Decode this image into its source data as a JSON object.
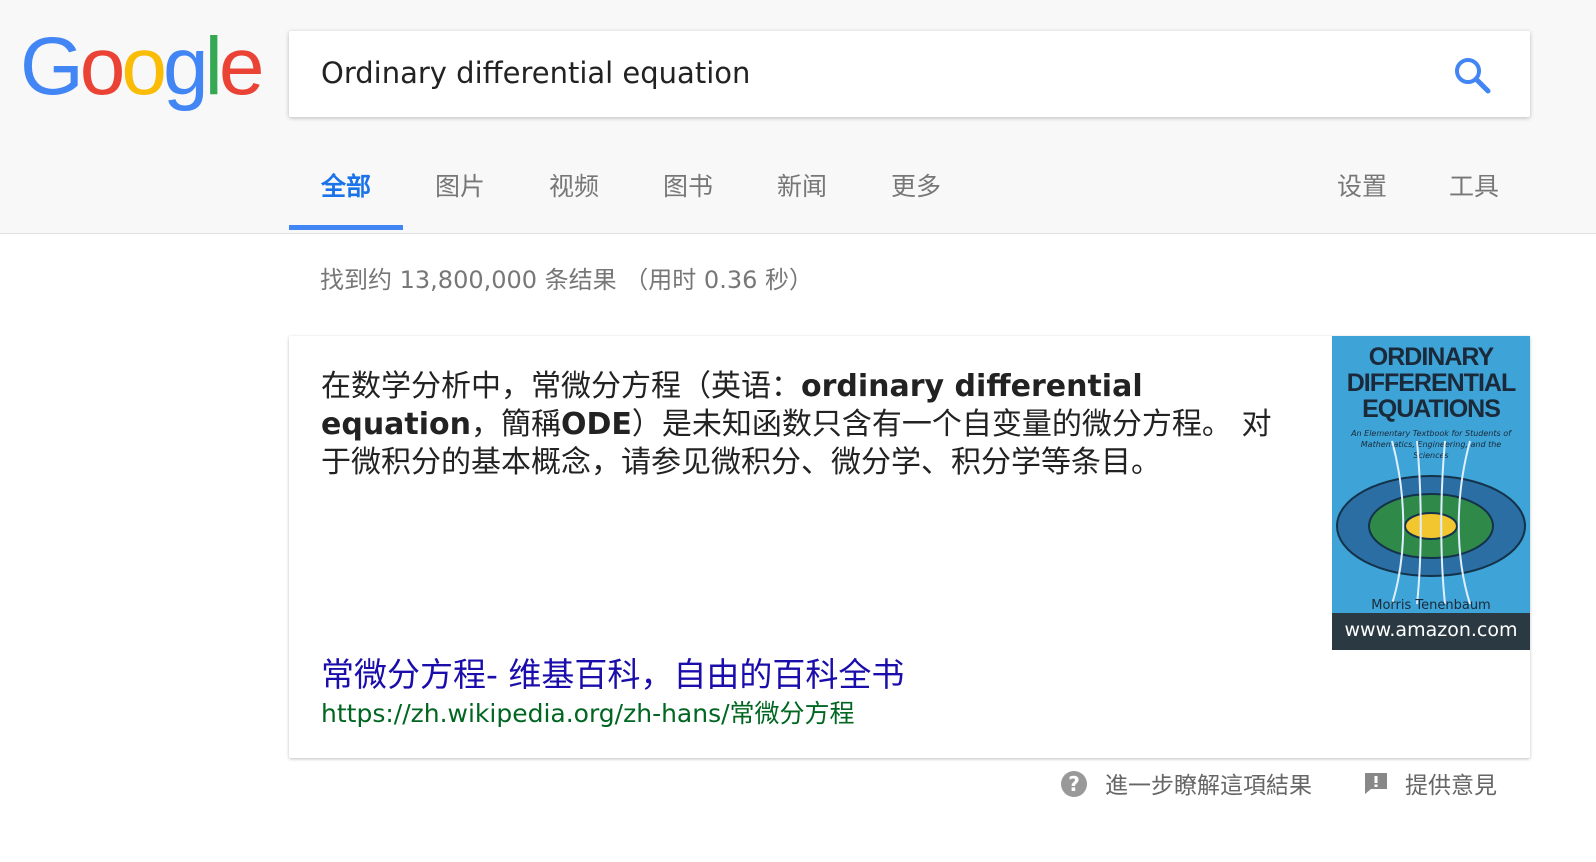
{
  "logo": {
    "text": "Google",
    "letters": [
      "G",
      "o",
      "o",
      "g",
      "l",
      "e"
    ],
    "colors": [
      "#4285f4",
      "#ea4335",
      "#fbbc05",
      "#4285f4",
      "#34a853",
      "#ea4335"
    ]
  },
  "search": {
    "query": "Ordinary differential equation",
    "icon": "search-icon"
  },
  "tabs": [
    {
      "label": "全部",
      "active": true
    },
    {
      "label": "图片"
    },
    {
      "label": "视频"
    },
    {
      "label": "图书"
    },
    {
      "label": "新闻"
    },
    {
      "label": "更多"
    },
    {
      "label": "设置"
    },
    {
      "label": "工具"
    }
  ],
  "result_stats": "找到约 13,800,000 条结果 （用时 0.36 秒）",
  "featured_snippet": {
    "desc_part1": "在数学分析中，常微分方程（英语：",
    "desc_bold1": "ordinary differential equation",
    "desc_part2": "，簡稱",
    "desc_bold2": "ODE",
    "desc_part3": "）是未知函数只含有一个自变量的微分方程。 对于微积分的基本概念，请参见微积分、微分学、积分学等条目。",
    "link_title": "常微分方程- 维基百科，自由的百科全书",
    "link_url": "https://zh.wikipedia.org/zh-hans/常微分方程",
    "image": {
      "cover_title_lines": [
        "ORDINARY",
        "DIFFERENTIAL",
        "EQUATIONS"
      ],
      "cover_subtitle": "An Elementary Textbook for Students of Mathematics, Engineering, and the Sciences",
      "cover_author": "Morris Tenenbaum",
      "caption": "www.amazon.com"
    }
  },
  "footer": {
    "learn_more": "進一步瞭解這項結果",
    "feedback": "提供意見"
  },
  "colors": {
    "accent": "#1a73e8",
    "link": "#1a0dab",
    "url": "#006621"
  }
}
